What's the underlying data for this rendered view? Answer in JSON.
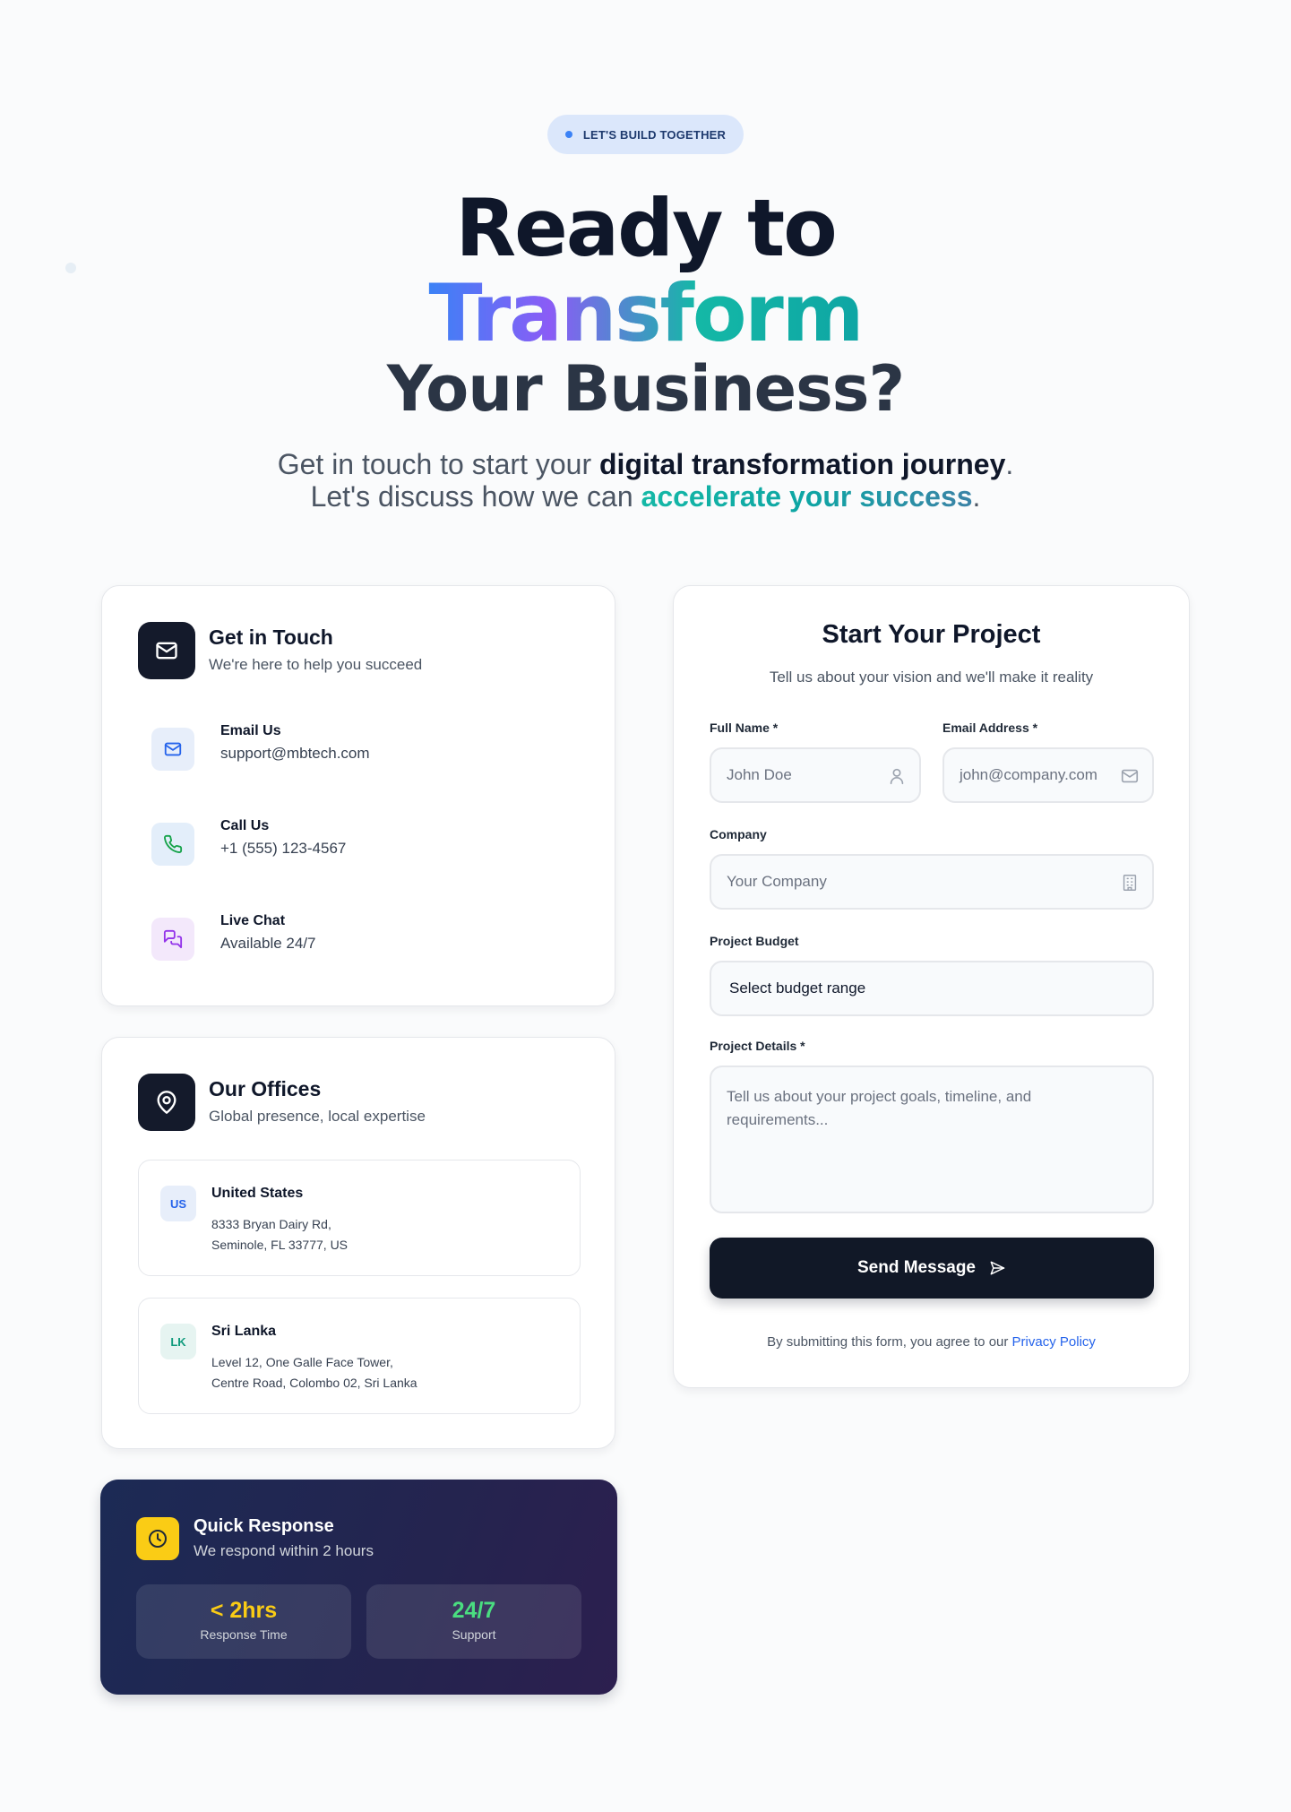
{
  "hero": {
    "badge": "LET'S BUILD TOGETHER",
    "title_line1": "Ready to",
    "title_line2": "Transform",
    "title_line3": "Your Business?",
    "subtitle_line1_plain": "Get in touch to start your ",
    "subtitle_line1_bold": "digital transformation journey",
    "subtitle_line1_end": ".",
    "subtitle_line2_plain": "Let's discuss how we can ",
    "subtitle_line2_accent": "accelerate your success",
    "subtitle_line2_end": "."
  },
  "contact_card": {
    "title": "Get in Touch",
    "subtitle": "We're here to help you succeed",
    "items": [
      {
        "icon": "mail-icon",
        "title": "Email Us",
        "value": "support@mbtech.com",
        "color": "#2563eb",
        "bg": "#e7eefa"
      },
      {
        "icon": "phone-icon",
        "title": "Call Us",
        "value": "+1 (555) 123-4567",
        "color": "#16a34a",
        "bg": "#e3eefa"
      },
      {
        "icon": "chat-icon",
        "title": "Live Chat",
        "value": "Available 24/7",
        "color": "#9333ea",
        "bg": "#f3e8fb"
      }
    ]
  },
  "offices_card": {
    "title": "Our Offices",
    "subtitle": "Global presence, local expertise",
    "offices": [
      {
        "code": "US",
        "name": "United States",
        "address_line1": "8333 Bryan Dairy Rd,",
        "address_line2": "Seminole, FL 33777, US"
      },
      {
        "code": "LK",
        "name": "Sri Lanka",
        "address_line1": "Level 12, One Galle Face Tower,",
        "address_line2": "Centre Road, Colombo 02, Sri Lanka"
      }
    ]
  },
  "quick_card": {
    "title": "Quick Response",
    "subtitle": "We respond within 2 hours",
    "stats": [
      {
        "value": "< 2hrs",
        "label": "Response Time",
        "color": "#facc15"
      },
      {
        "value": "24/7",
        "label": "Support",
        "color": "#4ade80"
      }
    ]
  },
  "form": {
    "title": "Start Your Project",
    "subtitle": "Tell us about your vision and we'll make it reality",
    "full_name_label": "Full Name *",
    "full_name_placeholder": "John Doe",
    "email_label": "Email Address *",
    "email_placeholder": "john@company.com",
    "company_label": "Company",
    "company_placeholder": "Your Company",
    "budget_label": "Project Budget",
    "budget_value": "Select budget range",
    "details_label": "Project Details *",
    "details_placeholder": "Tell us about your project goals, timeline, and requirements...",
    "submit_label": "Send Message",
    "legal_text": "By submitting this form, you agree to our ",
    "legal_link": "Privacy Policy"
  }
}
